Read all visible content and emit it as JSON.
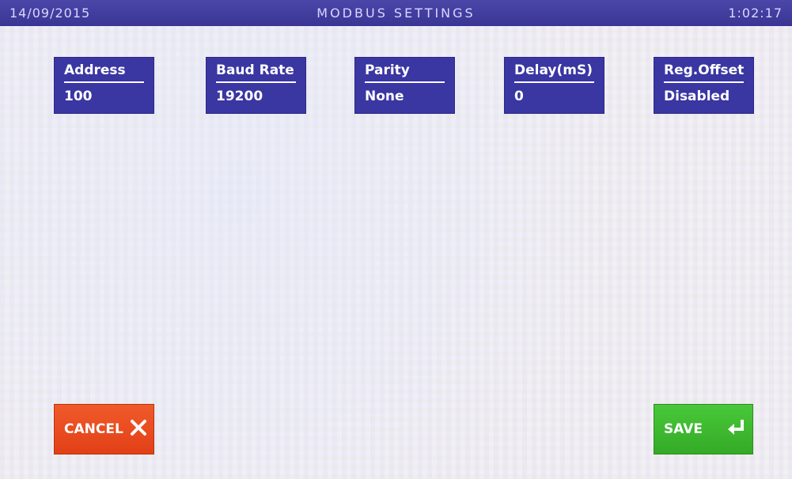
{
  "header": {
    "date": "14/09/2015",
    "title": "MODBUS SETTINGS",
    "time": "1:02:17"
  },
  "params": [
    {
      "label": "Address",
      "value": "100"
    },
    {
      "label": "Baud Rate",
      "value": "19200"
    },
    {
      "label": "Parity",
      "value": "None"
    },
    {
      "label": "Delay(mS)",
      "value": "0"
    },
    {
      "label": "Reg.Offset",
      "value": "Disabled"
    }
  ],
  "buttons": {
    "cancel_label": "CANCEL",
    "save_label": "SAVE"
  },
  "icons": {
    "cancel": "close-icon",
    "save": "enter-icon"
  },
  "colors": {
    "titlebar": "#3a3594",
    "param_box": "#3a36a2",
    "cancel": "#e24017",
    "save": "#34ab26"
  }
}
